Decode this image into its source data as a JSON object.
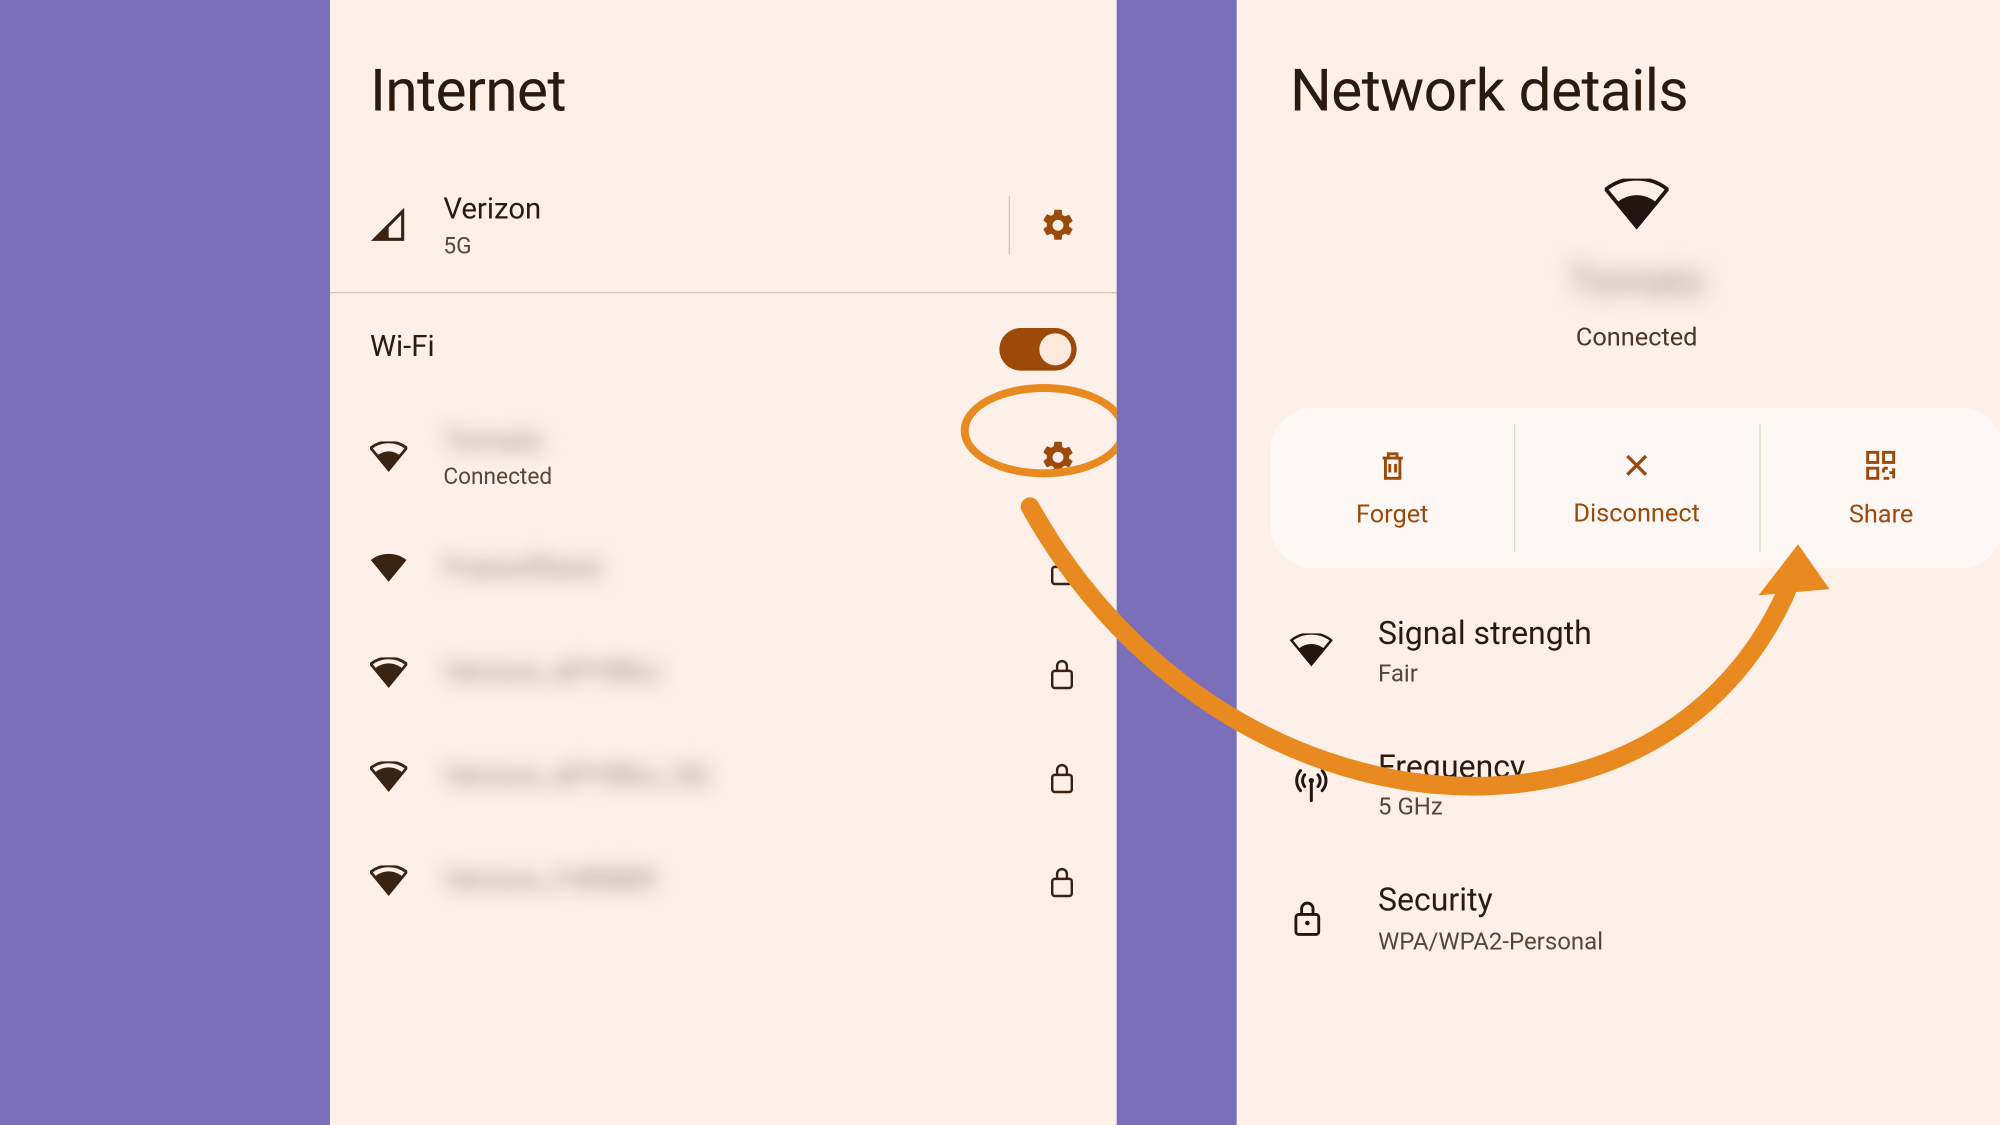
{
  "left_panel": {
    "title": "Internet",
    "carrier": {
      "name": "Verizon",
      "tech": "5G"
    },
    "wifi_label": "Wi-Fi",
    "wifi_enabled": true,
    "networks": [
      {
        "ssid": "Tomato",
        "status": "Connected",
        "secured": false,
        "highlighted_settings": true
      },
      {
        "ssid": "Freewifibest",
        "status": "",
        "secured": true
      },
      {
        "ssid": "Verizon_6PY8NJ",
        "status": "",
        "secured": true
      },
      {
        "ssid": "Verizon_6PY8NJ_5G",
        "status": "",
        "secured": true
      },
      {
        "ssid": "Verizon_F4R8B9",
        "status": "",
        "secured": true
      }
    ]
  },
  "right_panel": {
    "title": "Network details",
    "ssid": "Tomato",
    "status": "Connected",
    "actions": {
      "forget": "Forget",
      "disconnect": "Disconnect",
      "share": "Share"
    },
    "details": {
      "signal_label": "Signal strength",
      "signal_value": "Fair",
      "freq_label": "Frequency",
      "freq_value": "5 GHz",
      "security_label": "Security",
      "security_value": "WPA/WPA2-Personal"
    }
  },
  "colors": {
    "background": "#7a6fb8",
    "panel": "#fcf0e9",
    "accent": "#9b4a0a",
    "highlight": "#e88a1f"
  }
}
